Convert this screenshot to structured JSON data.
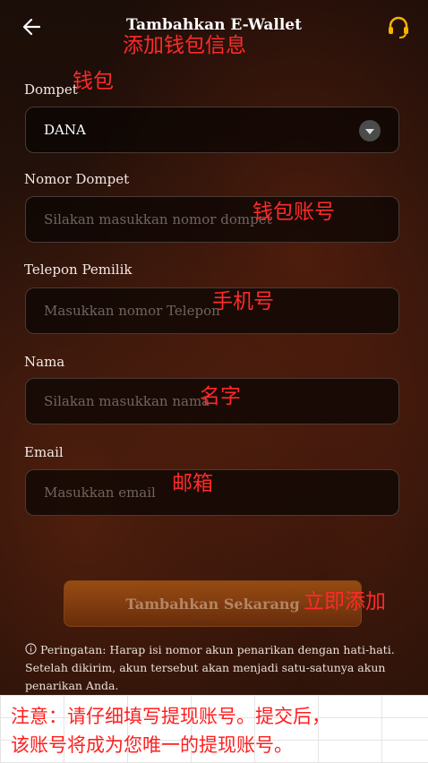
{
  "header": {
    "title": "Tambahkan E-Wallet",
    "title_annotation": "添加钱包信息"
  },
  "form": {
    "wallet": {
      "label": "Dompet",
      "annotation": "钱包",
      "selected": "DANA"
    },
    "wallet_number": {
      "label": "Nomor Dompet",
      "placeholder": "Silakan masukkan nomor dompet",
      "annotation": "钱包账号"
    },
    "phone": {
      "label": "Telepon Pemilik",
      "placeholder": "Masukkan nomor Telepon",
      "annotation": "手机号"
    },
    "name": {
      "label": "Nama",
      "placeholder": "Silakan masukkan nama",
      "annotation": "名字"
    },
    "email": {
      "label": "Email",
      "placeholder": "Masukkan email",
      "annotation": "邮箱"
    }
  },
  "submit": {
    "label": "Tambahkan Sekarang",
    "annotation": "立即添加"
  },
  "warning": {
    "text": "Peringatan: Harap isi nomor akun penarikan dengan hati-hati. Setelah dikirim, akun tersebut akan menjadi satu-satunya akun penarikan Anda."
  },
  "note": {
    "line1": "注意：请仔细填写提现账号。提交后，",
    "line2": "该账号将成为您唯一的提现账号。"
  },
  "colors": {
    "annotation_red": "#ff2a2a",
    "button_orange": "#a55514",
    "support_icon": "#f5b400"
  },
  "icons": {
    "back": "arrow-left-icon",
    "support": "headset-icon",
    "dropdown": "chevron-down-icon",
    "info": "info-icon"
  }
}
